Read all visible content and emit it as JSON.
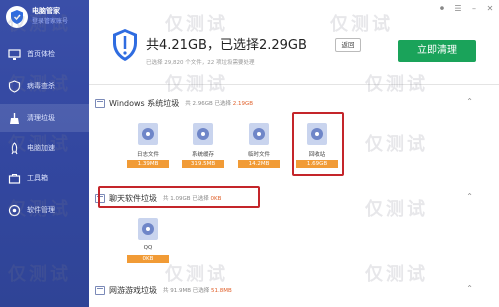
{
  "sidebar": {
    "brand_name": "电脑管家",
    "brand_link": "登录管家账号",
    "items": [
      {
        "label": "首页体检",
        "icon": "monitor-icon"
      },
      {
        "label": "病毒查杀",
        "icon": "shield-icon"
      },
      {
        "label": "清理垃圾",
        "icon": "broom-icon"
      },
      {
        "label": "电脑加速",
        "icon": "rocket-icon"
      },
      {
        "label": "工具箱",
        "icon": "toolbox-icon"
      },
      {
        "label": "软件管理",
        "icon": "apps-icon"
      }
    ]
  },
  "header": {
    "total": "共4.21GB，已选择2.29GB",
    "return_label": "返回",
    "subline": "已选择 29,820 个文件，22 项垃圾需要处理",
    "clean_label": "立即清理"
  },
  "windows_section": {
    "title": "Windows 系统垃圾",
    "meta_prefix": "共 2.96GB  已选择",
    "meta_selected": "2.19GB",
    "tiles": [
      {
        "label": "日志文件",
        "size": "1.39MB"
      },
      {
        "label": "系统缓存",
        "size": "319.5MB"
      },
      {
        "label": "临时文件",
        "size": "14.2MB"
      },
      {
        "label": "回收站",
        "size": "1.69GB"
      }
    ]
  },
  "chat_section": {
    "title": "聊天软件垃圾",
    "meta_prefix": "共 1.09GB  已选择",
    "meta_selected": "0KB",
    "tiles": [
      {
        "label": "QQ",
        "size": "0KB"
      }
    ]
  },
  "game_section": {
    "title": "网游游戏垃圾",
    "meta_prefix": "共 91.9MB  已选择",
    "meta_selected": "51.8MB"
  },
  "watermark": "仅测试",
  "colors": {
    "accent": "#1aa35a",
    "sidebar": "#3347a0",
    "highlight": "#c4252a",
    "size_fill": "#f19b36"
  }
}
